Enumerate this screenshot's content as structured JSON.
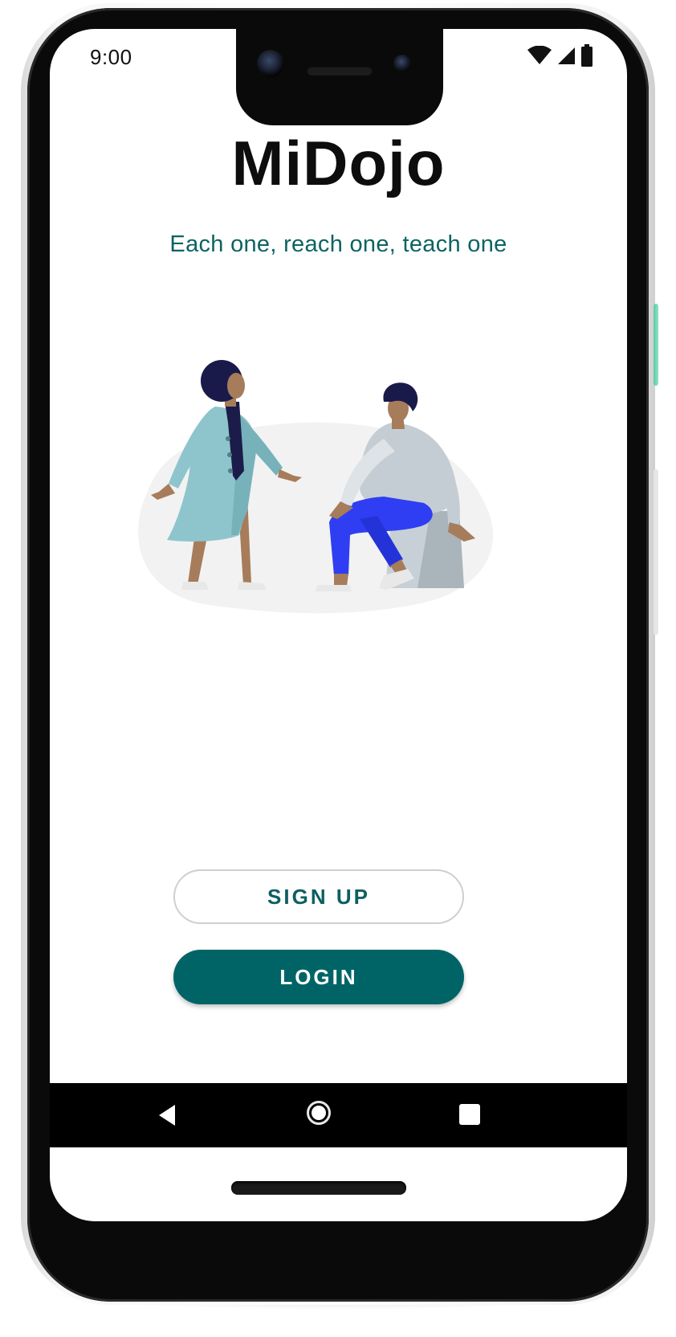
{
  "status_bar": {
    "time": "9:00",
    "icons": [
      "wifi-icon",
      "cell-signal-icon",
      "battery-icon"
    ]
  },
  "app": {
    "title": "MiDojo",
    "tagline": "Each one, reach one, teach one"
  },
  "illustration": {
    "subject": "two-people-talking",
    "colors": {
      "blob": "#f2f2f2",
      "coat": "#8ec5cc",
      "scarf": "#1c1c4a",
      "skin": "#a67c5a",
      "hair": "#1a1a4a",
      "sweater": "#c4cdd3",
      "pants": "#2f3ef3",
      "stool": "#aab4bb",
      "shoes": "#e6e6e6"
    }
  },
  "actions": {
    "signup_label": "SIGN UP",
    "login_label": "LOGIN"
  },
  "nav_bar": {
    "icons": [
      "back-icon",
      "home-icon",
      "recents-icon"
    ]
  },
  "theme": {
    "primary": "#006466",
    "tagline_color": "#0d6363",
    "title_color": "#0d0d0d"
  }
}
